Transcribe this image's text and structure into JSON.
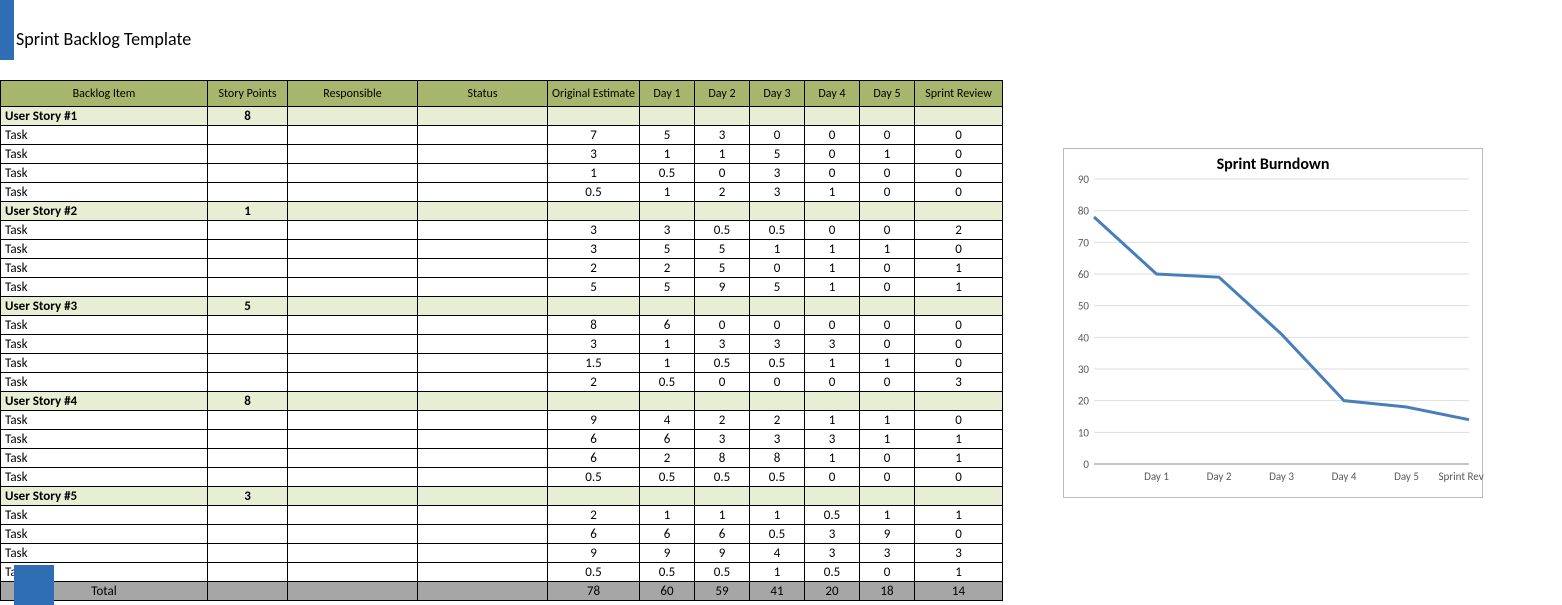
{
  "title": "Sprint Backlog Template",
  "headers": {
    "backlog": "Backlog Item",
    "points": "Story Points",
    "responsible": "Responsible",
    "status": "Status",
    "estimate": "Original Estimate",
    "d1": "Day 1",
    "d2": "Day 2",
    "d3": "Day 3",
    "d4": "Day 4",
    "d5": "Day 5",
    "review": "Sprint Review"
  },
  "stories": [
    {
      "name": "User Story #1",
      "points": 8,
      "tasks": [
        {
          "name": "Task",
          "est": 7,
          "d1": 5,
          "d2": 3,
          "d3": 0,
          "d4": 0,
          "d5": 0,
          "rev": 0
        },
        {
          "name": "Task",
          "est": 3,
          "d1": 1,
          "d2": 1,
          "d3": 5,
          "d4": 0,
          "d5": 1,
          "rev": 0
        },
        {
          "name": "Task",
          "est": 1,
          "d1": 0.5,
          "d2": 0,
          "d3": 3,
          "d4": 0,
          "d5": 0,
          "rev": 0
        },
        {
          "name": "Task",
          "est": 0.5,
          "d1": 1,
          "d2": 2,
          "d3": 3,
          "d4": 1,
          "d5": 0,
          "rev": 0
        }
      ]
    },
    {
      "name": "User Story #2",
      "points": 1,
      "tasks": [
        {
          "name": "Task",
          "est": 3,
          "d1": 3,
          "d2": 0.5,
          "d3": 0.5,
          "d4": 0,
          "d5": 0,
          "rev": 2
        },
        {
          "name": "Task",
          "est": 3,
          "d1": 5,
          "d2": 5,
          "d3": 1,
          "d4": 1,
          "d5": 1,
          "rev": 0
        },
        {
          "name": "Task",
          "est": 2,
          "d1": 2,
          "d2": 5,
          "d3": 0,
          "d4": 1,
          "d5": 0,
          "rev": 1
        },
        {
          "name": "Task",
          "est": 5,
          "d1": 5,
          "d2": 9,
          "d3": 5,
          "d4": 1,
          "d5": 0,
          "rev": 1
        }
      ]
    },
    {
      "name": "User Story #3",
      "points": 5,
      "tasks": [
        {
          "name": "Task",
          "est": 8,
          "d1": 6,
          "d2": 0,
          "d3": 0,
          "d4": 0,
          "d5": 0,
          "rev": 0
        },
        {
          "name": "Task",
          "est": 3,
          "d1": 1,
          "d2": 3,
          "d3": 3,
          "d4": 3,
          "d5": 0,
          "rev": 0
        },
        {
          "name": "Task",
          "est": 1.5,
          "d1": 1,
          "d2": 0.5,
          "d3": 0.5,
          "d4": 1,
          "d5": 1,
          "rev": 0
        },
        {
          "name": "Task",
          "est": 2,
          "d1": 0.5,
          "d2": 0,
          "d3": 0,
          "d4": 0,
          "d5": 0,
          "rev": 3
        }
      ]
    },
    {
      "name": "User Story #4",
      "points": 8,
      "tasks": [
        {
          "name": "Task",
          "est": 9,
          "d1": 4,
          "d2": 2,
          "d3": 2,
          "d4": 1,
          "d5": 1,
          "rev": 0
        },
        {
          "name": "Task",
          "est": 6,
          "d1": 6,
          "d2": 3,
          "d3": 3,
          "d4": 3,
          "d5": 1,
          "rev": 1
        },
        {
          "name": "Task",
          "est": 6,
          "d1": 2,
          "d2": 8,
          "d3": 8,
          "d4": 1,
          "d5": 0,
          "rev": 1
        },
        {
          "name": "Task",
          "est": 0.5,
          "d1": 0.5,
          "d2": 0.5,
          "d3": 0.5,
          "d4": 0,
          "d5": 0,
          "rev": 0
        }
      ]
    },
    {
      "name": "User Story #5",
      "points": 3,
      "tasks": [
        {
          "name": "Task",
          "est": 2,
          "d1": 1,
          "d2": 1,
          "d3": 1,
          "d4": 0.5,
          "d5": 1,
          "rev": 1
        },
        {
          "name": "Task",
          "est": 6,
          "d1": 6,
          "d2": 6,
          "d3": 0.5,
          "d4": 3,
          "d5": 9,
          "rev": 0
        },
        {
          "name": "Task",
          "est": 9,
          "d1": 9,
          "d2": 9,
          "d3": 4,
          "d4": 3,
          "d5": 3,
          "rev": 3
        },
        {
          "name": "Task",
          "est": 0.5,
          "d1": 0.5,
          "d2": 0.5,
          "d3": 1,
          "d4": 0.5,
          "d5": 0,
          "rev": 1
        }
      ]
    }
  ],
  "totals": {
    "label": "Total",
    "est": 78,
    "d1": 60,
    "d2": 59,
    "d3": 41,
    "d4": 20,
    "d5": 18,
    "rev": 14
  },
  "chart_data": {
    "type": "line",
    "title": "Sprint Burndown",
    "categories": [
      "Day 1",
      "Day 2",
      "Day 3",
      "Day 4",
      "Day 5",
      "Sprint Review"
    ],
    "values": [
      78,
      60,
      59,
      41,
      20,
      18,
      14
    ],
    "ylim": [
      0,
      90
    ],
    "yticks": [
      0,
      10,
      20,
      30,
      40,
      50,
      60,
      70,
      80,
      90
    ]
  }
}
